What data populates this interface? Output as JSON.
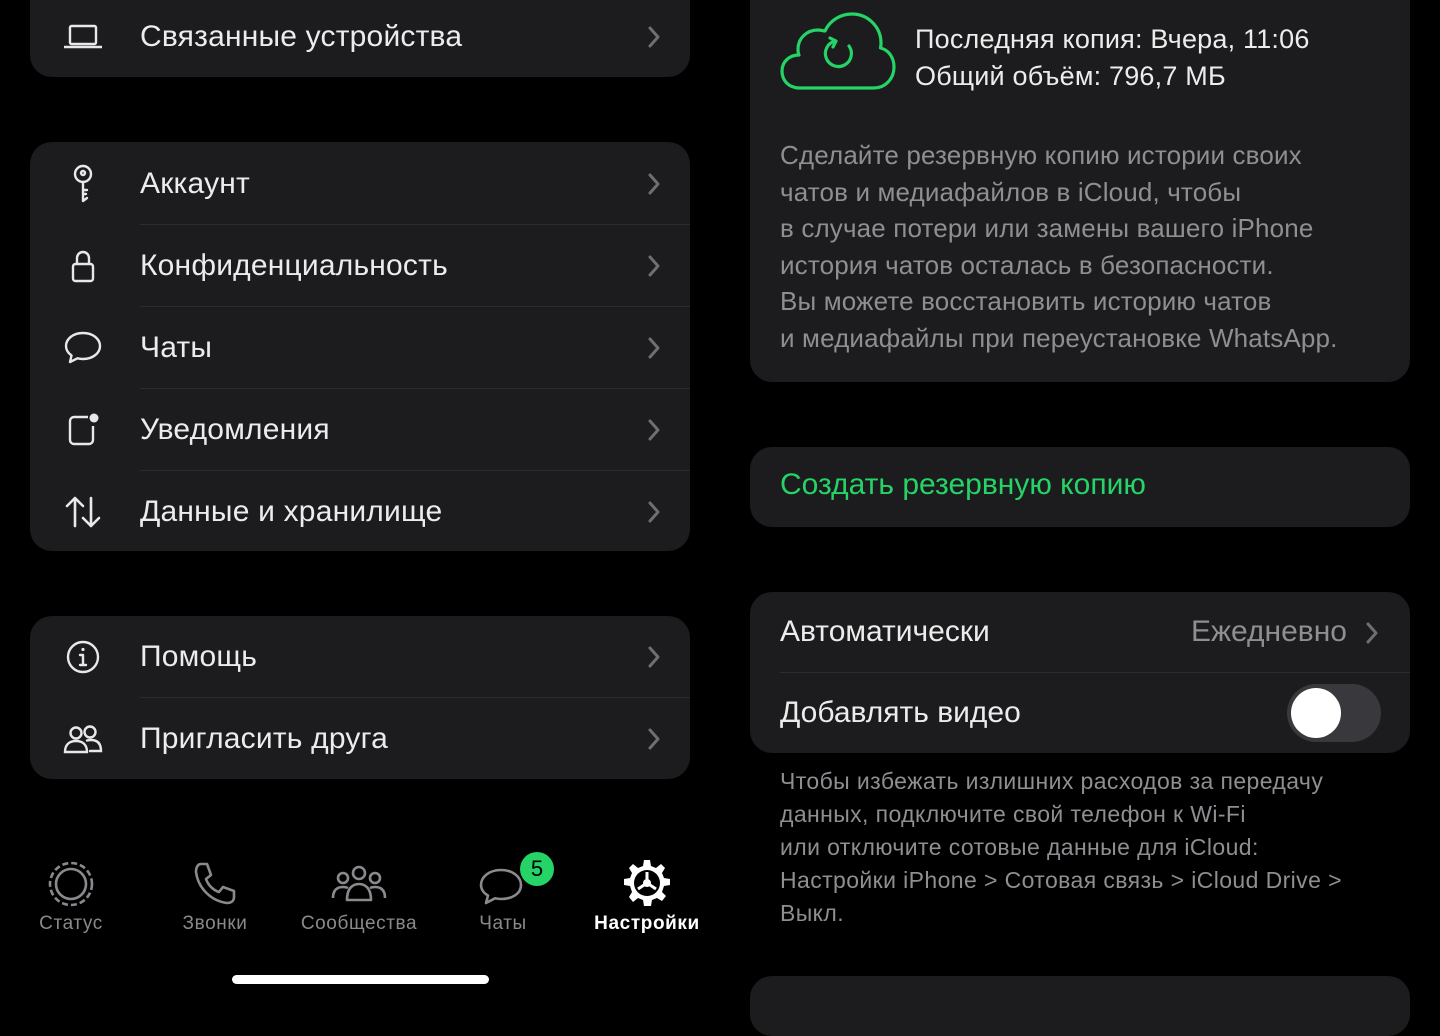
{
  "colors": {
    "background": "#000000",
    "panel": "#1c1c1e",
    "accent_green": "#25d366",
    "secondary_text": "#8e8e93"
  },
  "settings_groups": [
    {
      "items": [
        {
          "label": "Связанные устройства",
          "icon": "laptop-icon"
        }
      ]
    },
    {
      "items": [
        {
          "label": "Аккаунт",
          "icon": "key-icon"
        },
        {
          "label": "Конфиденциальность",
          "icon": "lock-icon"
        },
        {
          "label": "Чаты",
          "icon": "chat-bubble-icon"
        },
        {
          "label": "Уведомления",
          "icon": "notification-icon"
        },
        {
          "label": "Данные и хранилище",
          "icon": "up-down-arrows-icon"
        }
      ]
    },
    {
      "items": [
        {
          "label": "Помощь",
          "icon": "info-icon"
        },
        {
          "label": "Пригласить друга",
          "icon": "people-icon"
        }
      ]
    }
  ],
  "tab_bar": {
    "tabs": [
      {
        "label": "Статус",
        "icon": "status-ring-icon",
        "active": false
      },
      {
        "label": "Звонки",
        "icon": "phone-icon",
        "active": false
      },
      {
        "label": "Сообщества",
        "icon": "communities-icon",
        "active": false
      },
      {
        "label": "Чаты",
        "icon": "chats-icon",
        "active": false,
        "badge": "5"
      },
      {
        "label": "Настройки",
        "icon": "gear-icon",
        "active": true
      }
    ]
  },
  "backup": {
    "icon": "cloud-sync-icon",
    "last_backup": "Последняя копия: Вчера, 11:06",
    "total_size": "Общий объём: 796,7 МБ",
    "description_lines": [
      "Сделайте резервную копию истории своих",
      "чатов и медиафайлов в iCloud, чтобы",
      "в случае потери или замены вашего iPhone",
      "история чатов осталась в безопасности.",
      "Вы можете восстановить историю чатов",
      "и медиафайлы при переустановке WhatsApp."
    ],
    "action_label": "Создать резервную копию",
    "auto_label": "Автоматически",
    "auto_value": "Ежедневно",
    "video_label": "Добавлять видео",
    "video_enabled": false,
    "footnote_lines": [
      "Чтобы избежать излишних расходов за передачу",
      "данных, подключите свой телефон к Wi-Fi",
      "или отключите сотовые данные для iCloud:",
      "Настройки iPhone > Сотовая связь > iCloud Drive >",
      "Выкл."
    ]
  }
}
